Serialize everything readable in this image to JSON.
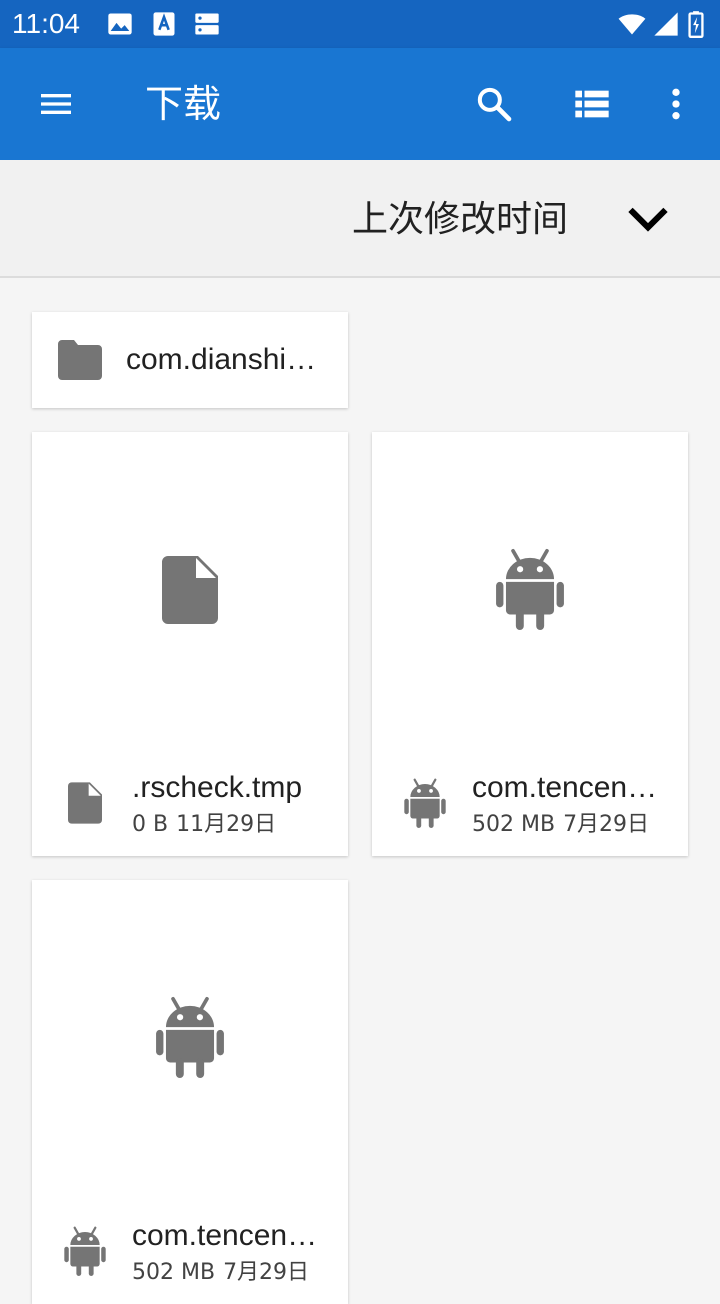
{
  "status_bar": {
    "time": "11:04",
    "left_icons": [
      "image-icon",
      "accessibility-icon",
      "storage-icon"
    ],
    "right_icons": [
      "wifi-icon",
      "signal-icon",
      "battery-icon"
    ]
  },
  "app_bar": {
    "title": "下载",
    "menu_icon": "menu-icon",
    "actions": [
      "search-icon",
      "list-view-icon",
      "more-vert-icon"
    ]
  },
  "sort_bar": {
    "label": "上次修改时间",
    "icon": "chevron-down-icon"
  },
  "folders": [
    {
      "name": "com.dianshi…"
    }
  ],
  "files": [
    {
      "name": ".rscheck.tmp",
      "size": "0 B",
      "date": "11月29日",
      "type": "document"
    },
    {
      "name": "com.tencen…",
      "size": "502 MB",
      "date": "7月29日",
      "type": "android"
    },
    {
      "name": "com.tencen…",
      "size": "502 MB",
      "date": "7月29日",
      "type": "android"
    }
  ],
  "colors": {
    "status_bar": "#1565c0",
    "app_bar": "#1976d2",
    "background": "#f5f5f5",
    "icon_gray": "#757575"
  }
}
